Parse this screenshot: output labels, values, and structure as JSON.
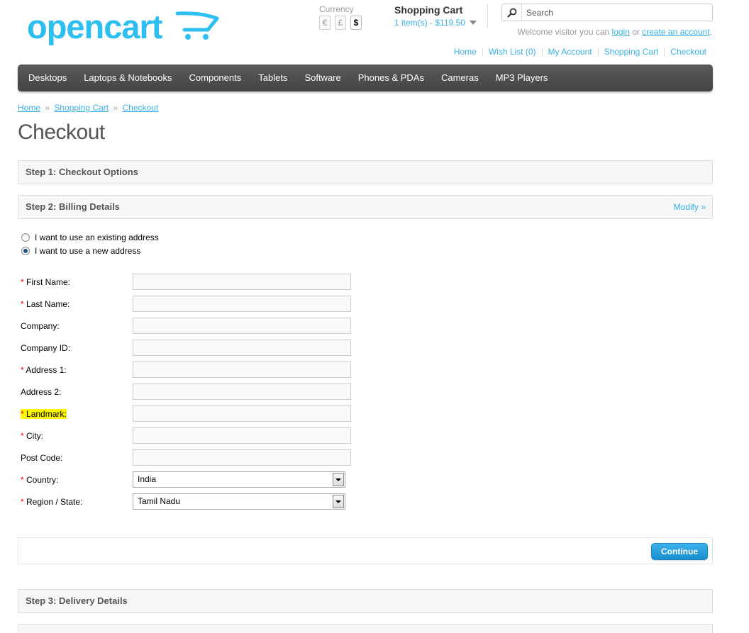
{
  "header": {
    "logo_text": "opencart",
    "currency_label": "Currency",
    "currencies": [
      "€",
      "£",
      "$"
    ],
    "active_currency": "$",
    "cart_title": "Shopping Cart",
    "cart_summary": "1 item(s) - $119.50",
    "search_placeholder": "Search",
    "welcome_prefix": "Welcome visitor you can ",
    "login_label": "login",
    "welcome_or": " or ",
    "create_account_label": "create an account",
    "welcome_suffix": ".",
    "links": [
      "Home",
      "Wish List (0)",
      "My Account",
      "Shopping Cart",
      "Checkout"
    ]
  },
  "menu": {
    "items": [
      "Desktops",
      "Laptops & Notebooks",
      "Components",
      "Tablets",
      "Software",
      "Phones & PDAs",
      "Cameras",
      "MP3 Players"
    ]
  },
  "breadcrumb": {
    "items": [
      "Home",
      "Shopping Cart",
      "Checkout"
    ],
    "separator": "»"
  },
  "page": {
    "title": "Checkout"
  },
  "steps": {
    "step1": "Step 1: Checkout Options",
    "step2": "Step 2: Billing Details",
    "step2_modify": "Modify »",
    "step3": "Step 3: Delivery Details"
  },
  "address_options": {
    "existing": "I want to use an existing address",
    "new": "I want to use a new address",
    "selected": "new"
  },
  "form": {
    "required_mark": "*",
    "first_name": "First Name:",
    "last_name": "Last Name:",
    "company": "Company:",
    "company_id": "Company ID:",
    "address_1": "Address 1:",
    "address_2": "Address 2:",
    "landmark": "Landmark:",
    "city": "City:",
    "post_code": "Post Code:",
    "country": "Country:",
    "country_value": "India",
    "region": "Region / State:",
    "region_value": "Tamil Nadu"
  },
  "buttons": {
    "continue": "Continue"
  },
  "colors": {
    "accent": "#38b0e3",
    "menu_bg": "#4f4f4f",
    "highlight": "#fff700",
    "required": "#ff0000"
  }
}
